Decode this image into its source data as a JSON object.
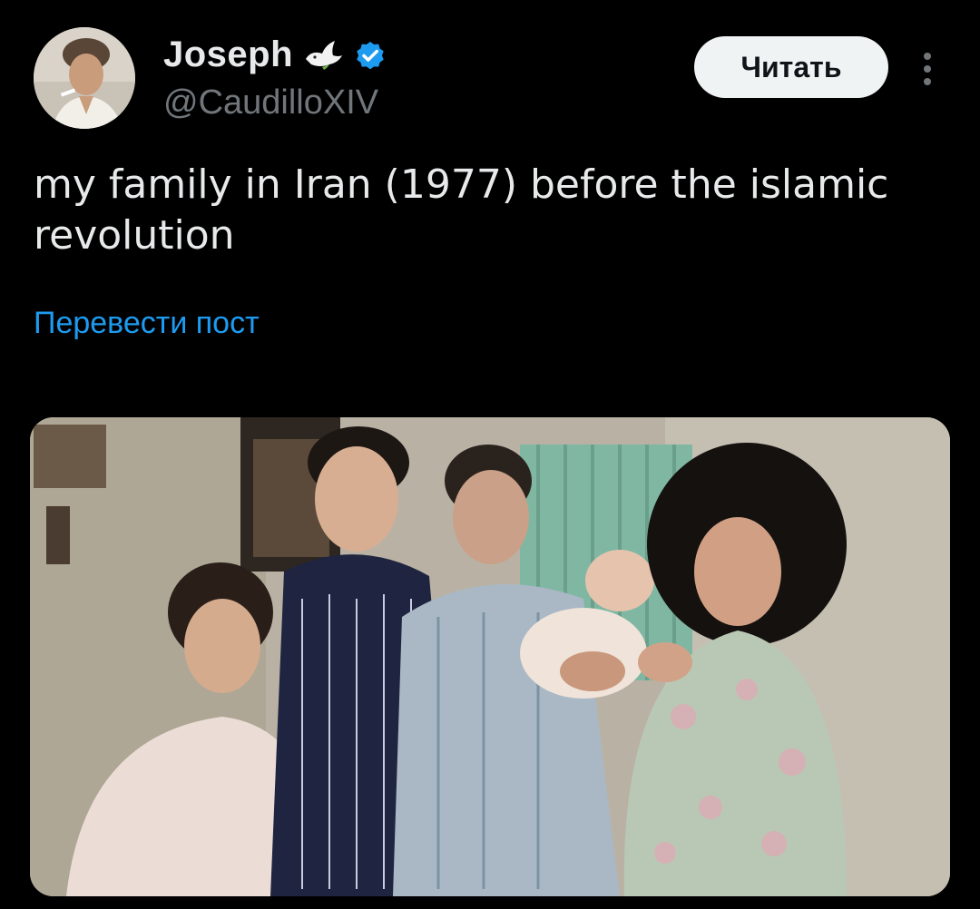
{
  "author": {
    "name": "Joseph",
    "handle": "@CaudilloXIV",
    "verified": true,
    "emoji_icon": "dove-icon",
    "verified_color": "#1d9bf0"
  },
  "header": {
    "follow_label": "Читать",
    "more_icon": "more-vertical-icon"
  },
  "tweet": {
    "text": "my family in Iran (1977) before the islamic revolution",
    "translate_label": "Перевести пост"
  },
  "media": {
    "type": "photo"
  },
  "colors": {
    "background": "#000000",
    "text": "#e7e9ea",
    "secondary_text": "#71767b",
    "link": "#1d9bf0",
    "button_bg": "#eff3f4"
  }
}
